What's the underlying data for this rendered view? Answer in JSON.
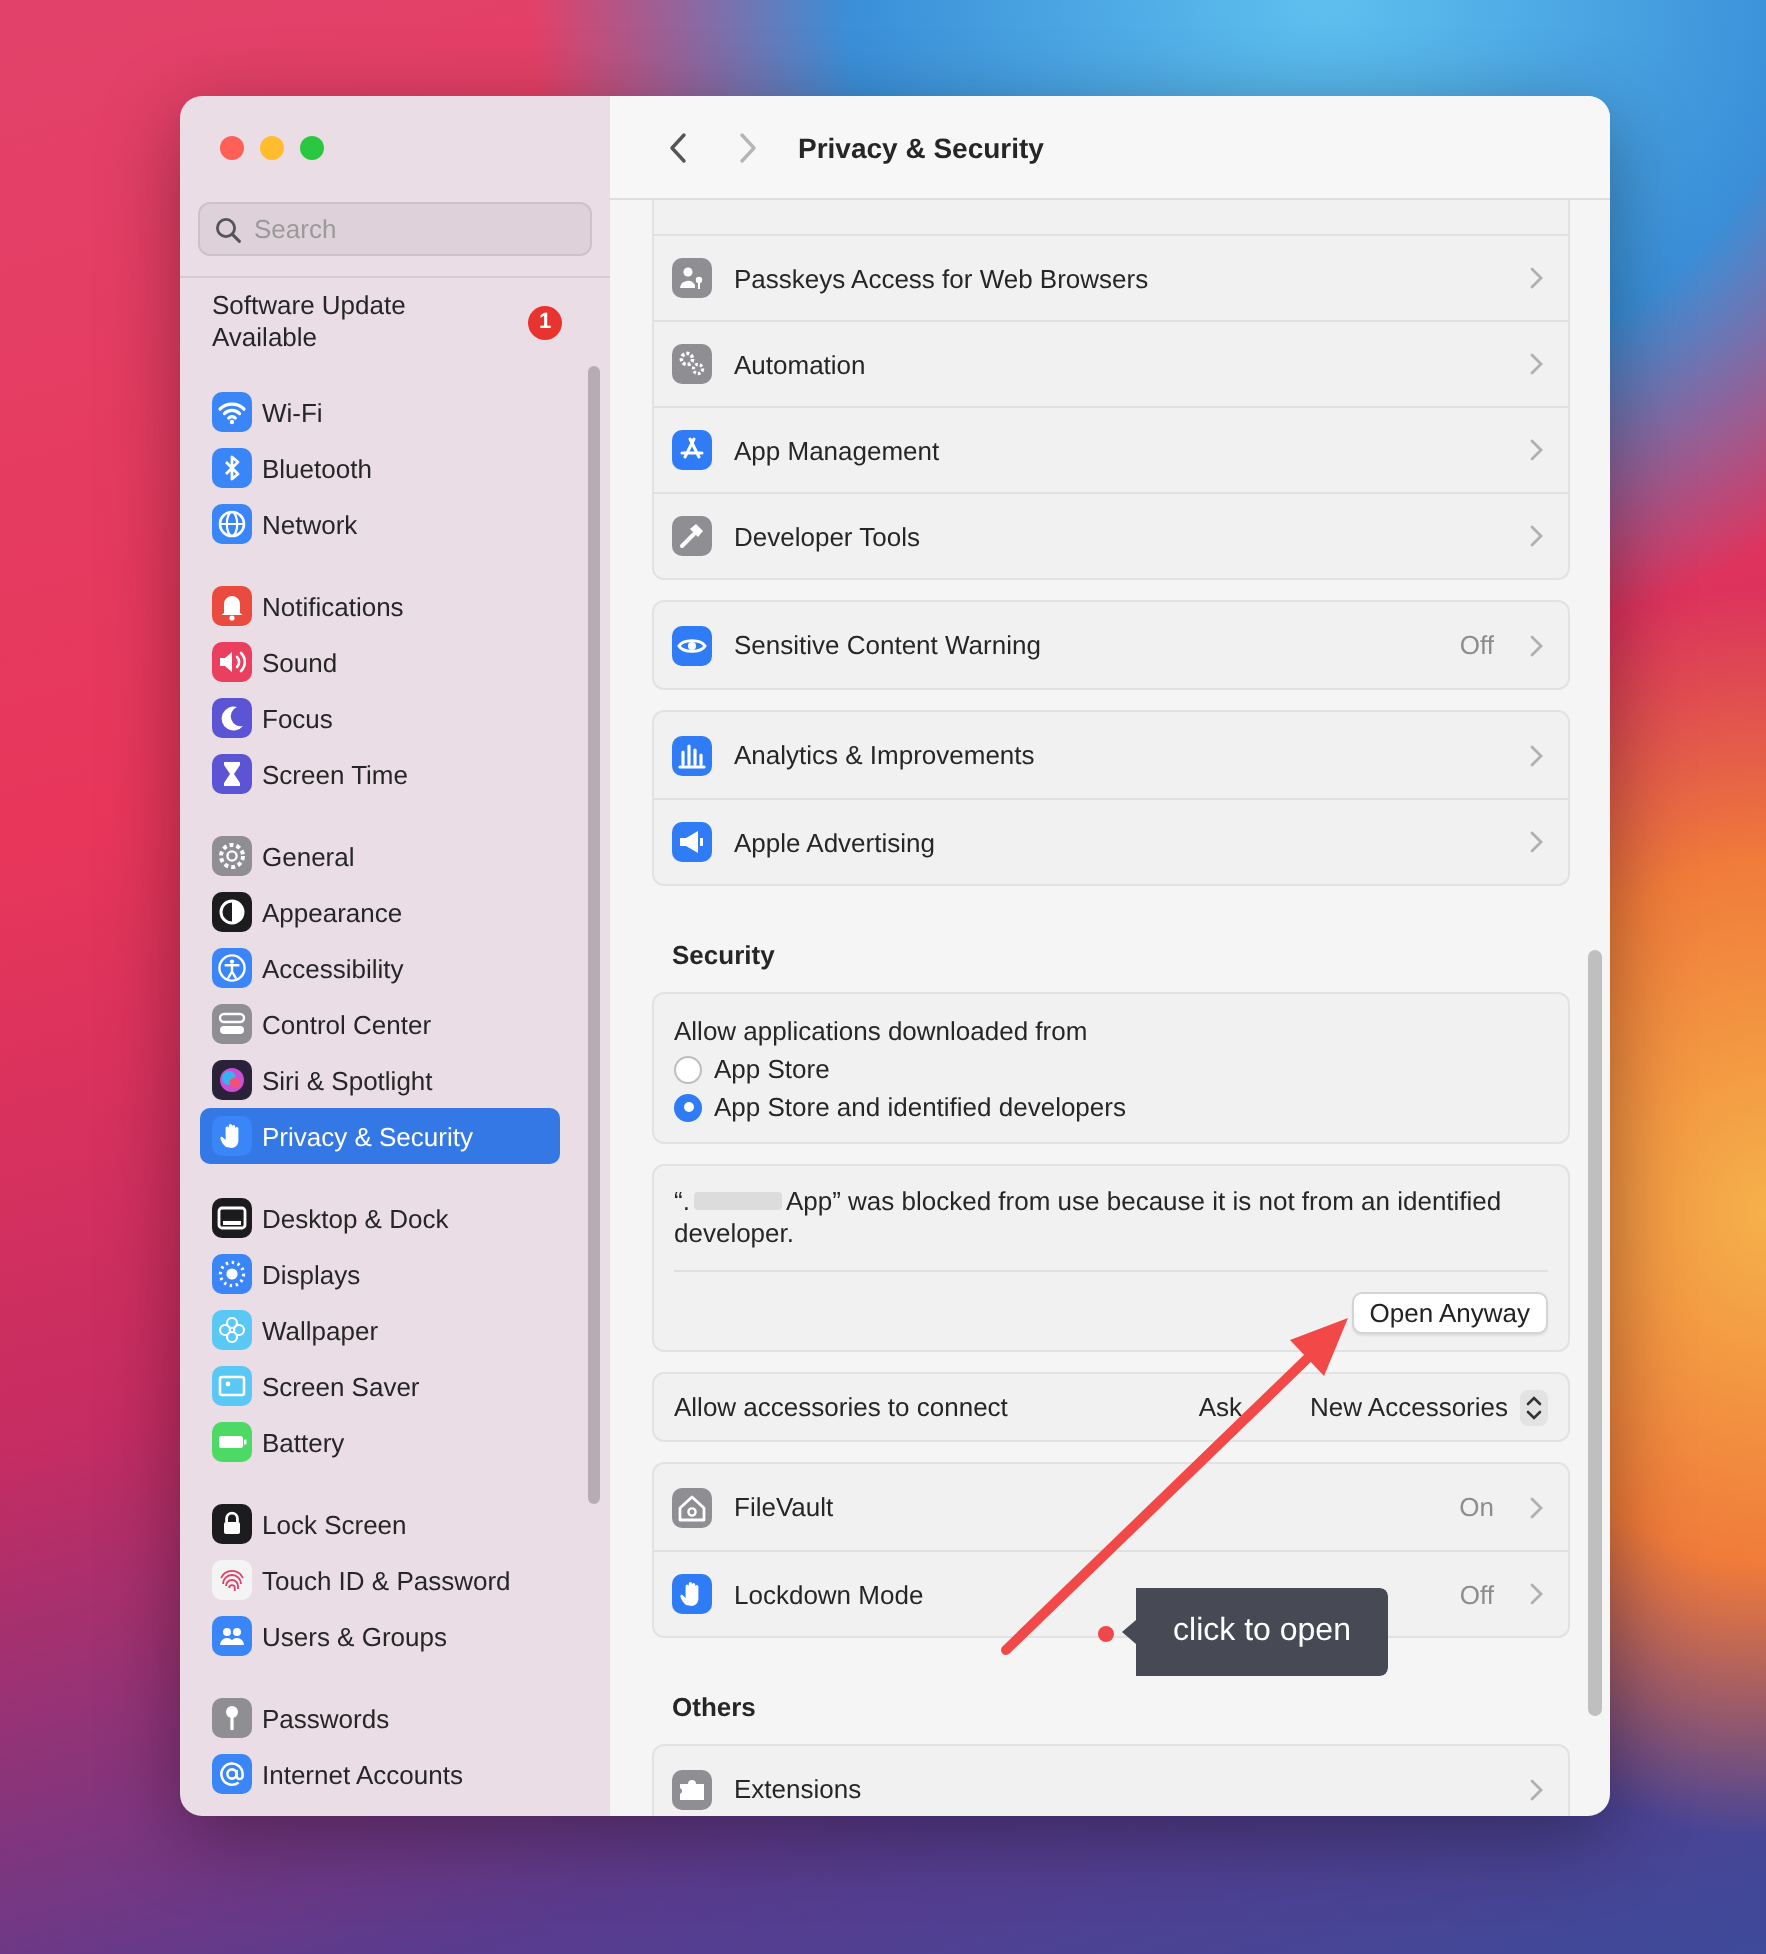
{
  "sidebar": {
    "search": {
      "placeholder": "Search"
    },
    "update": {
      "label": "Software Update Available",
      "badge": "1"
    },
    "groups": [
      {
        "items": [
          {
            "label": "Wi-Fi",
            "color": "#3a85f7",
            "selected": false
          },
          {
            "label": "Bluetooth",
            "color": "#3a85f7",
            "selected": false
          },
          {
            "label": "Network",
            "color": "#3a85f7",
            "selected": false
          }
        ]
      },
      {
        "items": [
          {
            "label": "Notifications",
            "color": "#eb4b3f",
            "selected": false
          },
          {
            "label": "Sound",
            "color": "#ea3f5e",
            "selected": false
          },
          {
            "label": "Focus",
            "color": "#5b55d6",
            "selected": false
          },
          {
            "label": "Screen Time",
            "color": "#5b55d6",
            "selected": false
          }
        ]
      },
      {
        "items": [
          {
            "label": "General",
            "color": "#8e8e93",
            "selected": false
          },
          {
            "label": "Appearance",
            "color": "#1c1c1e",
            "selected": false
          },
          {
            "label": "Accessibility",
            "color": "#3a85f7",
            "selected": false
          },
          {
            "label": "Control Center",
            "color": "#8e8e93",
            "selected": false
          },
          {
            "label": "Siri & Spotlight",
            "color": "#2a2238",
            "selected": false
          },
          {
            "label": "Privacy & Security",
            "color": "#3a85f7",
            "selected": true
          }
        ]
      },
      {
        "items": [
          {
            "label": "Desktop & Dock",
            "color": "#1c1c1e",
            "selected": false
          },
          {
            "label": "Displays",
            "color": "#3a85f7",
            "selected": false
          },
          {
            "label": "Wallpaper",
            "color": "#5ac8f5",
            "selected": false
          },
          {
            "label": "Screen Saver",
            "color": "#5ac8f5",
            "selected": false
          },
          {
            "label": "Battery",
            "color": "#4cd964",
            "selected": false
          }
        ]
      },
      {
        "items": [
          {
            "label": "Lock Screen",
            "color": "#1c1c1e",
            "selected": false
          },
          {
            "label": "Touch ID & Password",
            "color": "#f4f4f4",
            "selected": false
          },
          {
            "label": "Users & Groups",
            "color": "#3a85f7",
            "selected": false
          }
        ]
      },
      {
        "items": [
          {
            "label": "Passwords",
            "color": "#8e8e93",
            "selected": false
          },
          {
            "label": "Internet Accounts",
            "color": "#3a85f7",
            "selected": false
          }
        ]
      }
    ]
  },
  "header": {
    "title": "Privacy & Security",
    "back": {
      "disabled": false
    },
    "forward": {
      "disabled": true
    }
  },
  "content": [
    {
      "kind": "rows",
      "cut_top": true,
      "rows": [
        {
          "label": "Passkeys Access for Web Browsers",
          "color": "#8e8e93"
        },
        {
          "label": "Automation",
          "color": "#8e8e93"
        },
        {
          "label": "App Management",
          "color": "#2f7cf6"
        },
        {
          "label": "Developer Tools",
          "color": "#8e8e93"
        }
      ]
    },
    {
      "kind": "rows",
      "cut_top": false,
      "rows": [
        {
          "label": "Sensitive Content Warning",
          "value": "Off",
          "color": "#2f7cf6"
        }
      ]
    },
    {
      "kind": "rows",
      "cut_top": false,
      "rows": [
        {
          "label": "Analytics & Improvements",
          "color": "#2f7cf6"
        },
        {
          "label": "Apple Advertising",
          "color": "#2f7cf6"
        }
      ]
    },
    {
      "kind": "heading",
      "text": "Security"
    },
    {
      "kind": "radio_group",
      "label": "Allow applications downloaded from",
      "options": [
        {
          "label": "App Store",
          "selected": false
        },
        {
          "label": "App Store and identified developers",
          "selected": true
        }
      ]
    },
    {
      "kind": "notice",
      "text_before": "“.",
      "text_after": "App” was blocked from use because it is not from an identified developer.",
      "button": "Open Anyway"
    },
    {
      "kind": "popup",
      "label": "Allow accessories to connect",
      "value_parts": [
        "Ask",
        "New Accessories"
      ]
    },
    {
      "kind": "rows",
      "cut_top": false,
      "rows": [
        {
          "label": "FileVault",
          "value": "On",
          "color": "#8e8e93"
        },
        {
          "label": "Lockdown Mode",
          "value": "Off",
          "color": "#2f7cf6"
        }
      ]
    },
    {
      "kind": "heading",
      "text": "Others"
    },
    {
      "kind": "rows",
      "cut_top": false,
      "rows": [
        {
          "label": "Extensions",
          "color": "#8e8e93"
        }
      ]
    }
  ],
  "annotation": {
    "tooltip": "click to open"
  }
}
